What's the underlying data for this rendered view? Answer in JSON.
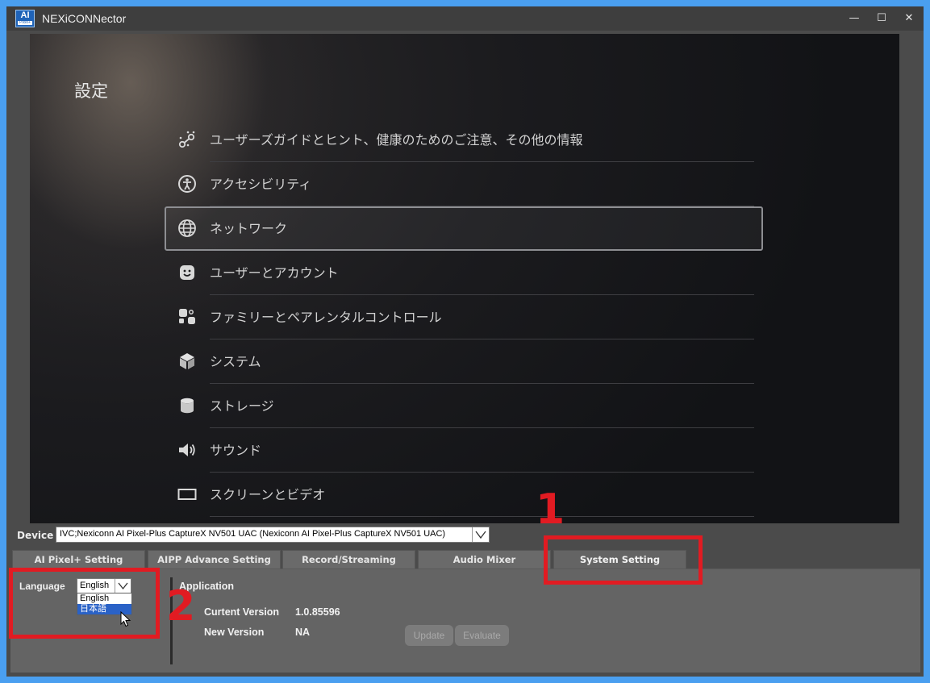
{
  "window": {
    "logo_text": "AI",
    "logo_subtext": "Pixel+",
    "title": "NEXiCONNector",
    "minimize_glyph": "—",
    "maximize_glyph": "☐",
    "close_glyph": "✕"
  },
  "settings_screen": {
    "title": "設定",
    "items": [
      {
        "label": "ユーザーズガイドとヒント、健康のためのご注意、その他の情報",
        "icon": "user-guide-icon"
      },
      {
        "label": "アクセシビリティ",
        "icon": "accessibility-icon"
      },
      {
        "label": "ネットワーク",
        "icon": "network-globe-icon",
        "selected": true
      },
      {
        "label": "ユーザーとアカウント",
        "icon": "user-face-icon"
      },
      {
        "label": "ファミリーとペアレンタルコントロール",
        "icon": "family-icon"
      },
      {
        "label": "システム",
        "icon": "system-cube-icon"
      },
      {
        "label": "ストレージ",
        "icon": "storage-icon"
      },
      {
        "label": "サウンド",
        "icon": "speaker-icon"
      },
      {
        "label": "スクリーンとビデオ",
        "icon": "screen-icon"
      }
    ]
  },
  "device": {
    "label": "Device",
    "selected": "IVC;Nexiconn AI Pixel-Plus CaptureX NV501 UAC (Nexiconn AI Pixel-Plus CaptureX NV501 UAC)"
  },
  "tabs": [
    {
      "label": "AI Pixel+ Setting"
    },
    {
      "label": "AIPP Advance Setting"
    },
    {
      "label": "Record/Streaming"
    },
    {
      "label": "Audio Mixer"
    },
    {
      "label": "System Setting",
      "active": true
    }
  ],
  "language": {
    "label": "Language",
    "selected": "English",
    "options": [
      "English",
      "日本語"
    ],
    "highlighted": "日本語"
  },
  "application": {
    "heading": "Application",
    "current_version_label": "Curtent Version",
    "current_version_value": "1.0.85596",
    "new_version_label": "New Version",
    "new_version_value": "NA",
    "update_label": "Update",
    "evaluate_label": "Evaluate"
  },
  "annotations": {
    "step1": "1",
    "step2": "2"
  },
  "colors": {
    "annotation_red": "#e11b22",
    "window_border": "#4a9ff0",
    "highlight_blue": "#2a62c7"
  }
}
